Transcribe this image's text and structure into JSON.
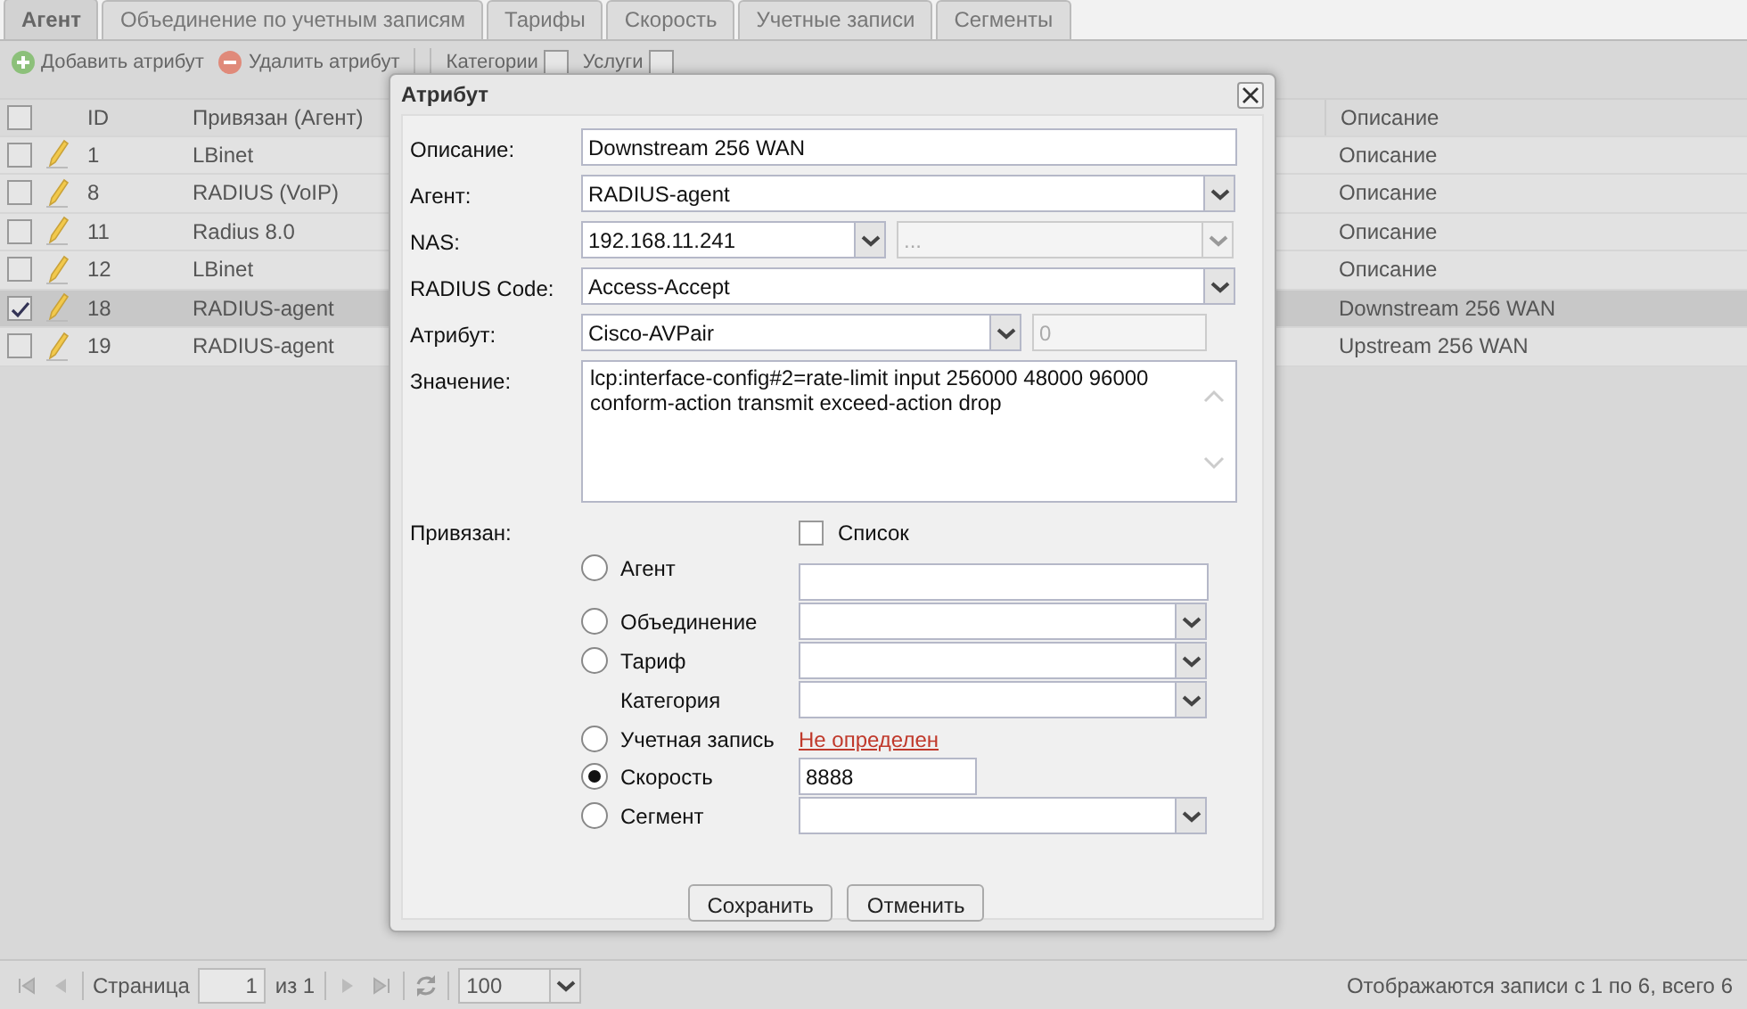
{
  "tabs": [
    {
      "label": "Агент",
      "selected": true
    },
    {
      "label": "Объединение по учетным записям",
      "selected": false
    },
    {
      "label": "Тарифы",
      "selected": false
    },
    {
      "label": "Скорость",
      "selected": false
    },
    {
      "label": "Учетные записи",
      "selected": false
    },
    {
      "label": "Сегменты",
      "selected": false
    }
  ],
  "toolbar": [
    {
      "kind": "add",
      "label": "Добавить атрибут"
    },
    {
      "kind": "remove",
      "label": "Удалить атрибут"
    },
    {
      "kind": "check",
      "label": "Категории",
      "checked": false
    },
    {
      "kind": "check",
      "label": "Услуги",
      "checked": false
    }
  ],
  "grid": {
    "all_selected": false,
    "columns": [
      "ID",
      "Привязан (Агент)",
      "Описание"
    ],
    "rows": [
      {
        "id": "1",
        "bound": "LBinet",
        "description": "Описание",
        "selected": false
      },
      {
        "id": "8",
        "bound": "RADIUS (VoIP)",
        "description": "Описание",
        "selected": false
      },
      {
        "id": "11",
        "bound": "Radius 8.0",
        "description": "Описание",
        "selected": false
      },
      {
        "id": "12",
        "bound": "LBinet",
        "description": "Описание",
        "selected": false
      },
      {
        "id": "18",
        "bound": "RADIUS-agent",
        "description": "Downstream 256 WAN",
        "selected": true
      },
      {
        "id": "19",
        "bound": "RADIUS-agent",
        "description": "Upstream 256 WAN",
        "selected": false
      }
    ]
  },
  "dialog": {
    "title": "Атрибут",
    "fields": [
      {
        "kind": "text",
        "label": "Описание:",
        "value": "Downstream 256 WAN"
      },
      {
        "kind": "combo",
        "label": "Агент:",
        "value": "RADIUS-agent"
      },
      {
        "kind": "combo",
        "label": "NAS:",
        "value": "192.168.11.241",
        "extra": {
          "kind": "combo",
          "value": "...",
          "disabled": true
        }
      },
      {
        "kind": "combo",
        "label": "RADIUS Code:",
        "value": "Access-Accept"
      },
      {
        "kind": "combo",
        "label": "Атрибут:",
        "value": "Cisco-AVPair",
        "extra": {
          "kind": "text",
          "value": "0",
          "disabled": true
        }
      },
      {
        "kind": "textarea",
        "label": "Значение:",
        "value": "lcp:interface-config#2=rate-limit input 256000 48000 96000 conform-action transmit exceed-action drop"
      }
    ],
    "binding": {
      "label": "Привязан:",
      "list": {
        "label": "Список",
        "checked": false
      },
      "options": [
        {
          "kind": "radio",
          "label": "Агент",
          "selected": false,
          "control": {
            "kind": "text"
          }
        },
        {
          "kind": "radio",
          "label": "Объединение",
          "selected": false,
          "control": {
            "kind": "combo"
          }
        },
        {
          "kind": "radio",
          "label": "Тариф",
          "selected": false,
          "control": {
            "kind": "combo"
          }
        },
        {
          "kind": "plain",
          "label": "Категория",
          "control": {
            "kind": "combo"
          }
        },
        {
          "kind": "radio",
          "label": "Учетная запись",
          "selected": false,
          "control": {
            "kind": "link",
            "value": "Не определен"
          }
        },
        {
          "kind": "radio",
          "label": "Скорость",
          "selected": true,
          "control": {
            "kind": "short",
            "value": "8888"
          }
        },
        {
          "kind": "radio",
          "label": "Сегмент",
          "selected": false,
          "control": {
            "kind": "combo"
          }
        }
      ]
    },
    "buttons": [
      "Сохранить",
      "Отменить"
    ]
  },
  "pager": {
    "page_label": "Страница",
    "page": "1",
    "of": "из 1",
    "page_size": "100",
    "summary": "Отображаются записи с 1 по 6, всего 6"
  }
}
